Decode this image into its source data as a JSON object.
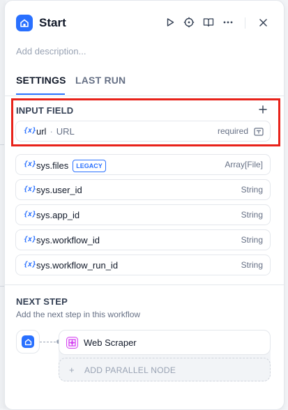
{
  "header": {
    "title": "Start",
    "description_placeholder": "Add description..."
  },
  "tabs": [
    {
      "label": "SETTINGS",
      "active": true
    },
    {
      "label": "LAST RUN",
      "active": false
    }
  ],
  "input_field": {
    "label": "INPUT FIELD",
    "items": [
      {
        "name": "url",
        "label": "URL",
        "type": "required"
      }
    ]
  },
  "system_variables": [
    {
      "name": "sys.files",
      "badge": "LEGACY",
      "type": "Array[File]"
    },
    {
      "name": "sys.user_id",
      "type": "String"
    },
    {
      "name": "sys.app_id",
      "type": "String"
    },
    {
      "name": "sys.workflow_id",
      "type": "String"
    },
    {
      "name": "sys.workflow_run_id",
      "type": "String"
    }
  ],
  "variable_icon": "{x}",
  "next_step": {
    "label": "NEXT STEP",
    "description": "Add the next step in this workflow",
    "node_label": "Web Scraper",
    "add_parallel_label": "ADD PARALLEL NODE",
    "add_parallel_icon": "+"
  },
  "icons": {
    "start": "home-icon",
    "run": "play-icon",
    "locate": "crosshair-icon",
    "docs": "book-icon",
    "more": "more-icon",
    "close": "close-icon",
    "add": "plus-icon",
    "required": "text-input-icon",
    "web_scraper": "web-scraper-icon"
  },
  "colors": {
    "accent": "#2970ff",
    "highlight": "#e8221a",
    "web_scraper": "#d444f1"
  }
}
